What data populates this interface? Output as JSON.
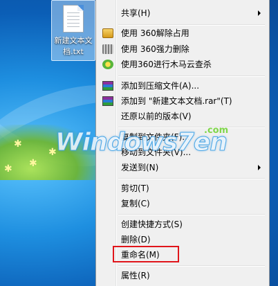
{
  "desktop": {
    "file_icon_label": "新建文本文档.txt"
  },
  "watermark": {
    "text": "Windows7en",
    "com": ".com"
  },
  "menu": {
    "items": [
      {
        "label": "共享(H)",
        "submenu": true
      },
      {
        "label": "使用 360解除占用",
        "icon": "360-unlock-icon"
      },
      {
        "label": "使用 360强力删除",
        "icon": "shredder-icon"
      },
      {
        "label": "使用360进行木马云查杀",
        "icon": "360-scan-icon"
      },
      {
        "label": "添加到压缩文件(A)...",
        "icon": "winrar-icon"
      },
      {
        "label": "添加到 \"新建文本文档.rar\"(T)",
        "icon": "winrar-icon"
      },
      {
        "label": "还原以前的版本(V)"
      },
      {
        "label": "复制到文件夹(F)..."
      },
      {
        "label": "移动到文件夹(V)..."
      },
      {
        "label": "发送到(N)",
        "submenu": true
      },
      {
        "label": "剪切(T)"
      },
      {
        "label": "复制(C)"
      },
      {
        "label": "创建快捷方式(S)"
      },
      {
        "label": "删除(D)"
      },
      {
        "label": "重命名(M)",
        "highlighted": true
      },
      {
        "label": "属性(R)"
      }
    ]
  },
  "colors": {
    "highlight_box": "#e0141a",
    "menu_bg": "#f0f0f0"
  }
}
